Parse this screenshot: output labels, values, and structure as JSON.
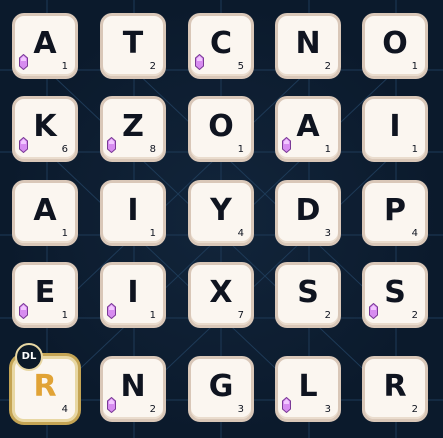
{
  "board": {
    "rows": [
      [
        {
          "letter": "A",
          "points": "1",
          "gem": true
        },
        {
          "letter": "T",
          "points": "2",
          "gem": false
        },
        {
          "letter": "C",
          "points": "5",
          "gem": true
        },
        {
          "letter": "N",
          "points": "2",
          "gem": false
        },
        {
          "letter": "O",
          "points": "1",
          "gem": false
        }
      ],
      [
        {
          "letter": "K",
          "points": "6",
          "gem": true
        },
        {
          "letter": "Z",
          "points": "8",
          "gem": true
        },
        {
          "letter": "O",
          "points": "1",
          "gem": false
        },
        {
          "letter": "A",
          "points": "1",
          "gem": true
        },
        {
          "letter": "I",
          "points": "1",
          "gem": false
        }
      ],
      [
        {
          "letter": "A",
          "points": "1",
          "gem": false
        },
        {
          "letter": "I",
          "points": "1",
          "gem": false
        },
        {
          "letter": "Y",
          "points": "4",
          "gem": false
        },
        {
          "letter": "D",
          "points": "3",
          "gem": false
        },
        {
          "letter": "P",
          "points": "4",
          "gem": false
        }
      ],
      [
        {
          "letter": "E",
          "points": "1",
          "gem": true
        },
        {
          "letter": "I",
          "points": "1",
          "gem": true
        },
        {
          "letter": "X",
          "points": "7",
          "gem": false
        },
        {
          "letter": "S",
          "points": "2",
          "gem": false
        },
        {
          "letter": "S",
          "points": "2",
          "gem": true
        }
      ],
      [
        {
          "letter": "R",
          "points": "4",
          "gem": false,
          "bonus": "DL"
        },
        {
          "letter": "N",
          "points": "2",
          "gem": true
        },
        {
          "letter": "G",
          "points": "3",
          "gem": false
        },
        {
          "letter": "L",
          "points": "3",
          "gem": true
        },
        {
          "letter": "R",
          "points": "2",
          "gem": false
        }
      ]
    ]
  },
  "colors": {
    "background": "#0b1a2c",
    "tile": "#fbf6f0",
    "tile_border": "#d9c7b8",
    "gem": "#d78cf0",
    "bonus_letter": "#e1a336",
    "bonus_ring": "#e8d7a3"
  },
  "icons": {
    "gem": "gem-icon"
  }
}
